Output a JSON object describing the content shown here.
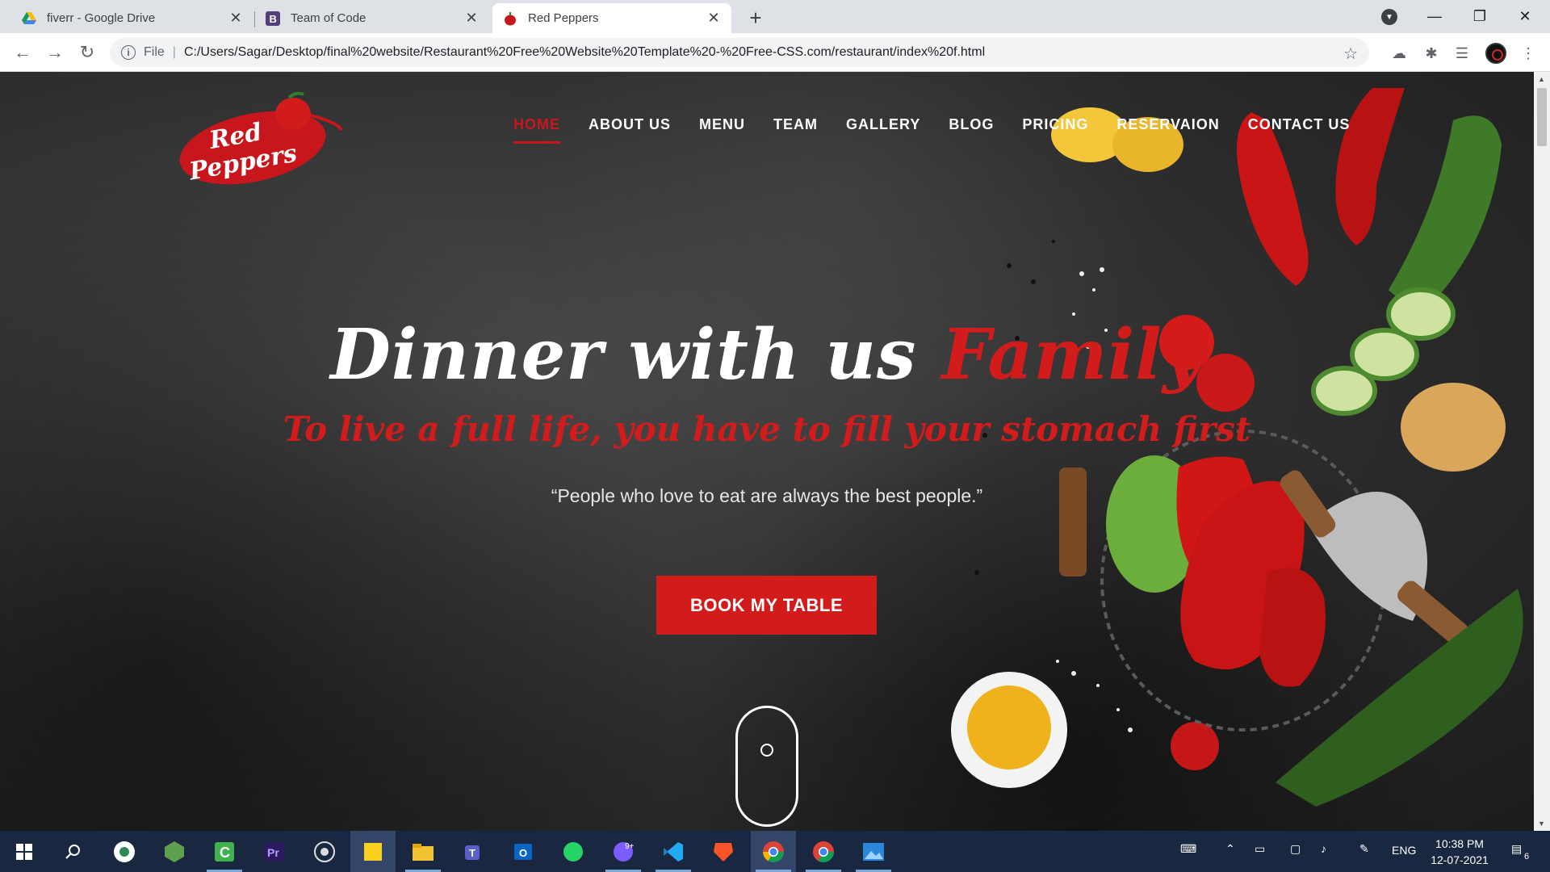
{
  "browser": {
    "tabs": [
      {
        "title": "fiverr - Google Drive",
        "icon": "google-drive-icon",
        "active": false
      },
      {
        "title": "Team of Code",
        "icon": "bootstrap-icon",
        "active": false
      },
      {
        "title": "Red Peppers",
        "icon": "red-pepper-icon",
        "active": true
      }
    ],
    "address": {
      "scheme": "File",
      "url": "C:/Users/Sagar/Desktop/final%20website/Restaurant%20Free%20Website%20Template%20-%20Free-CSS.com/restaurant/index%20f.html"
    }
  },
  "site": {
    "logo": {
      "line1": "Red",
      "line2": "Peppers"
    },
    "nav": [
      {
        "label": "HOME",
        "active": true
      },
      {
        "label": "ABOUT US",
        "active": false
      },
      {
        "label": "MENU",
        "active": false
      },
      {
        "label": "TEAM",
        "active": false
      },
      {
        "label": "GALLERY",
        "active": false
      },
      {
        "label": "BLOG",
        "active": false
      },
      {
        "label": "PRICING",
        "active": false
      },
      {
        "label": "RESERVAION",
        "active": false
      },
      {
        "label": "CONTACT US",
        "active": false
      }
    ],
    "hero": {
      "title_main": "Dinner with us ",
      "title_accent": "Family",
      "subtitle": "To live a full life, you have to fill your stomach first",
      "quote": "“People who love to eat are always the best people.”",
      "cta": "BOOK MY TABLE"
    },
    "colors": {
      "accent": "#d21b1b",
      "text": "#ffffff"
    }
  },
  "taskbar": {
    "apps": [
      "windows-start-icon",
      "search-icon",
      "chrome-alt-icon",
      "node-icon",
      "camtasia-icon",
      "premiere-icon",
      "obs-icon",
      "sticky-notes-icon",
      "file-explorer-icon",
      "teams-icon",
      "outlook-icon",
      "whatsapp-icon",
      "messenger-icon",
      "vscode-icon",
      "brave-icon",
      "chrome-icon",
      "chrome-profile-icon",
      "photos-icon"
    ],
    "badge": "9+",
    "language": "ENG",
    "time": "10:38 PM",
    "date": "12-07-2021",
    "notifications": "6"
  }
}
